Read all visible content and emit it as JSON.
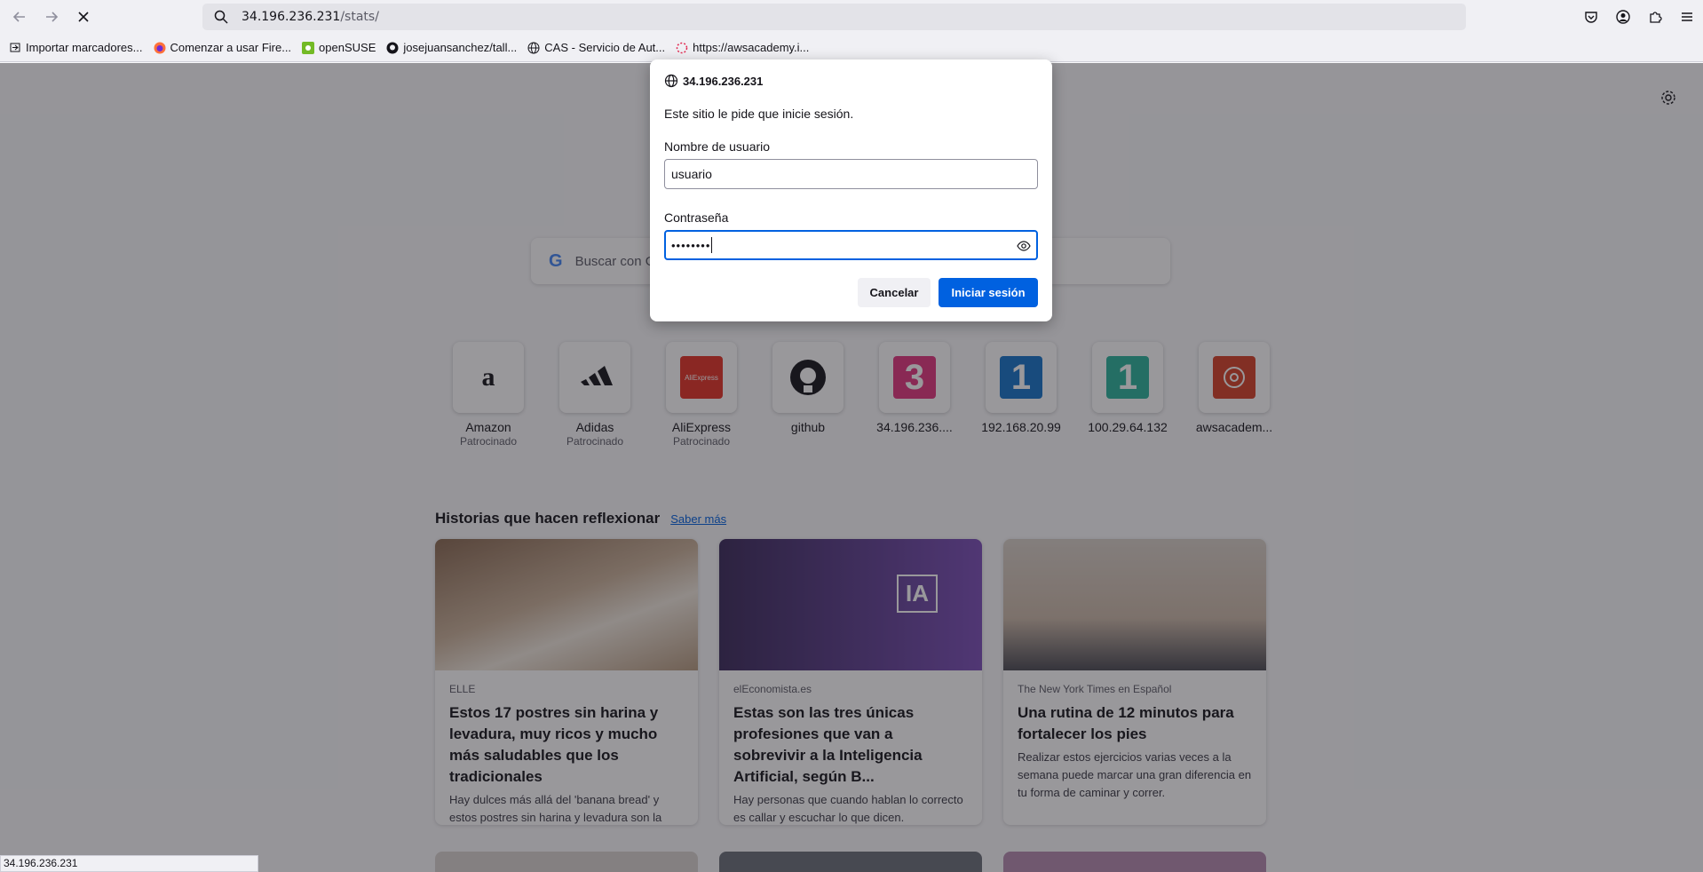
{
  "browser": {
    "url_host": "34.196.236.231",
    "url_path": "/stats/",
    "status_url": "34.196.236.231"
  },
  "bookmarks": [
    {
      "label": "Importar marcadores...",
      "icon": "import-icon"
    },
    {
      "label": "Comenzar a usar Fire...",
      "icon": "firefox-icon"
    },
    {
      "label": "openSUSE",
      "icon": "opensuse-icon"
    },
    {
      "label": "josejuansanchez/tall...",
      "icon": "github-icon"
    },
    {
      "label": "CAS - Servicio de Aut...",
      "icon": "globe-icon"
    },
    {
      "label": "https://awsacademy.i...",
      "icon": "loading-icon"
    }
  ],
  "newtab": {
    "search_placeholder": "Buscar con Google o introducir dirección",
    "shortcuts": [
      {
        "name": "Amazon",
        "sponsored": "Patrocinado",
        "icon": "amazon-logo",
        "color": "#ffffff"
      },
      {
        "name": "Adidas",
        "sponsored": "Patrocinado",
        "icon": "adidas-logo",
        "color": "#ffffff"
      },
      {
        "name": "AliExpress",
        "sponsored": "Patrocinado",
        "icon": "aliexpress-logo",
        "color": "#e43225"
      },
      {
        "name": "github",
        "sponsored": "",
        "icon": "github-logo",
        "color": "#ffffff"
      },
      {
        "name": "34.196.236....",
        "sponsored": "",
        "icon": "digit-3-tile",
        "color": "#e2367f"
      },
      {
        "name": "192.168.20.99",
        "sponsored": "",
        "icon": "digit-1-tile",
        "color": "#1573c9"
      },
      {
        "name": "100.29.64.132",
        "sponsored": "",
        "icon": "digit-1-tile",
        "color": "#2bb39c"
      },
      {
        "name": "awsacadem...",
        "sponsored": "",
        "icon": "canvas-logo",
        "color": "#d64027"
      }
    ],
    "stories_title": "Historias que hacen reflexionar",
    "stories_link": "Saber más",
    "cards": [
      {
        "source": "ELLE",
        "title": "Estos 17 postres sin harina y levadura, muy ricos y mucho más saludables que los tradicionales",
        "excerpt": "Hay dulces más allá del 'banana bread' y estos postres sin harina y levadura son la prueba perfecta de que vas a poder segu..."
      },
      {
        "source": "elEconomista.es",
        "title": "Estas son las tres únicas profesiones que van a sobrevivir a la Inteligencia Artificial, según B...",
        "excerpt": "Hay personas que cuando hablan lo correcto es callar y escuchar lo que dicen."
      },
      {
        "source": "The New York Times en Español",
        "title": "Una rutina de 12 minutos para fortalecer los pies",
        "excerpt": "Realizar estos ejercicios varias veces a la semana puede marcar una gran diferencia en tu forma de caminar y correr."
      }
    ],
    "ia_badge": "IA"
  },
  "dialog": {
    "host": "34.196.236.231",
    "message": "Este sitio le pide que inicie sesión.",
    "username_label": "Nombre de usuario",
    "username_value": "usuario",
    "password_label": "Contraseña",
    "password_mask": "••••••••",
    "cancel_label": "Cancelar",
    "submit_label": "Iniciar sesión"
  },
  "colors": {
    "accent": "#0061e0",
    "toolbar": "#f0f0f4"
  }
}
